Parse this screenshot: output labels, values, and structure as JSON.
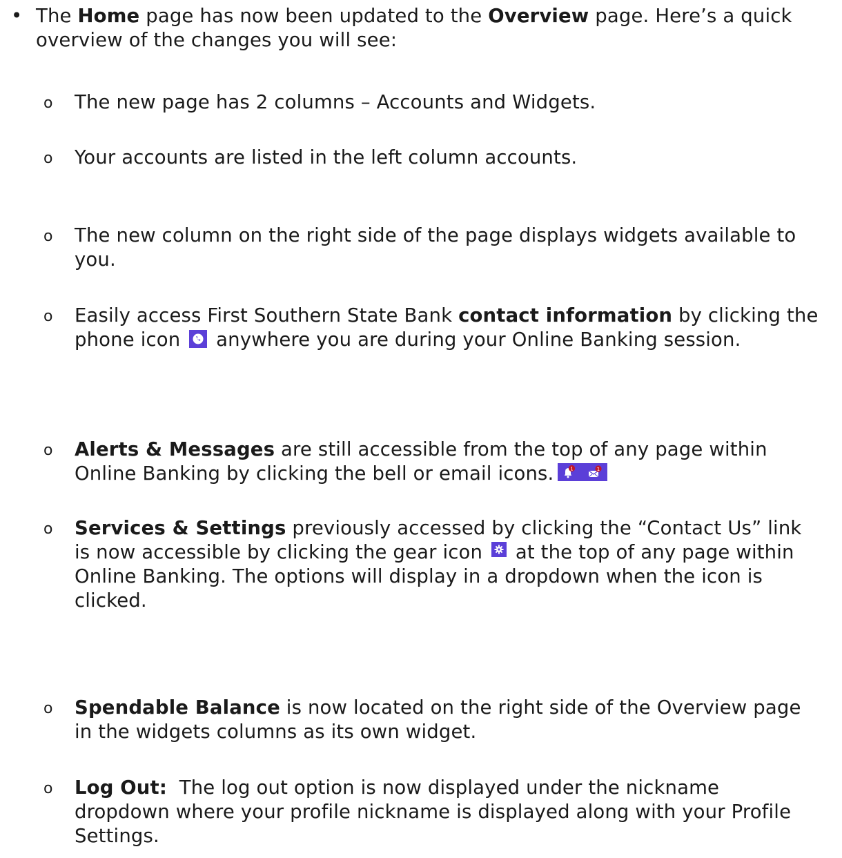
{
  "bullet": {
    "pre": "The ",
    "home": "Home",
    "mid": " page has now been updated to the ",
    "overview": "Overview",
    "post": " page. Here’s a quick overview of the changes you will see:"
  },
  "subs": {
    "s1": "The new page has 2 columns – Accounts and Widgets.",
    "s2": "Your accounts are listed in the left column accounts.",
    "s3": "The new column on the right side of the page displays widgets available to you.",
    "s4_pre": "Easily access First Southern State Bank ",
    "s4_bold": "contact information",
    "s4_mid": " by clicking the phone icon ",
    "s4_post": " anywhere you are during your Online Banking session.",
    "s5_bold": "Alerts & Messages",
    "s5_text": " are still accessible from the top of any page within Online Banking by clicking the bell or email icons.",
    "s6_bold": "Services & Settings",
    "s6_pre": " previously accessed by clicking the “Contact Us” link is now accessible by clicking the gear icon ",
    "s6_post": " at the top of any page within Online Banking.  The options will display in a dropdown when the icon is clicked.",
    "s7_bold": "Spendable Balance",
    "s7_text": " is now located on the right side of the Overview page in the widgets columns as its own widget.",
    "s8_bold": "Log Out:",
    "s8_text": "  The log out option is now displayed under the nickname dropdown where your profile nickname is displayed along with your Profile Settings."
  },
  "markers": {
    "bullet": "•",
    "sub": "o"
  },
  "icons": {
    "phone": "phone-icon",
    "bell": "bell-icon",
    "email": "email-icon",
    "gear": "gear-icon",
    "accent": "#5b3fd8",
    "badge": "#c0152a"
  }
}
